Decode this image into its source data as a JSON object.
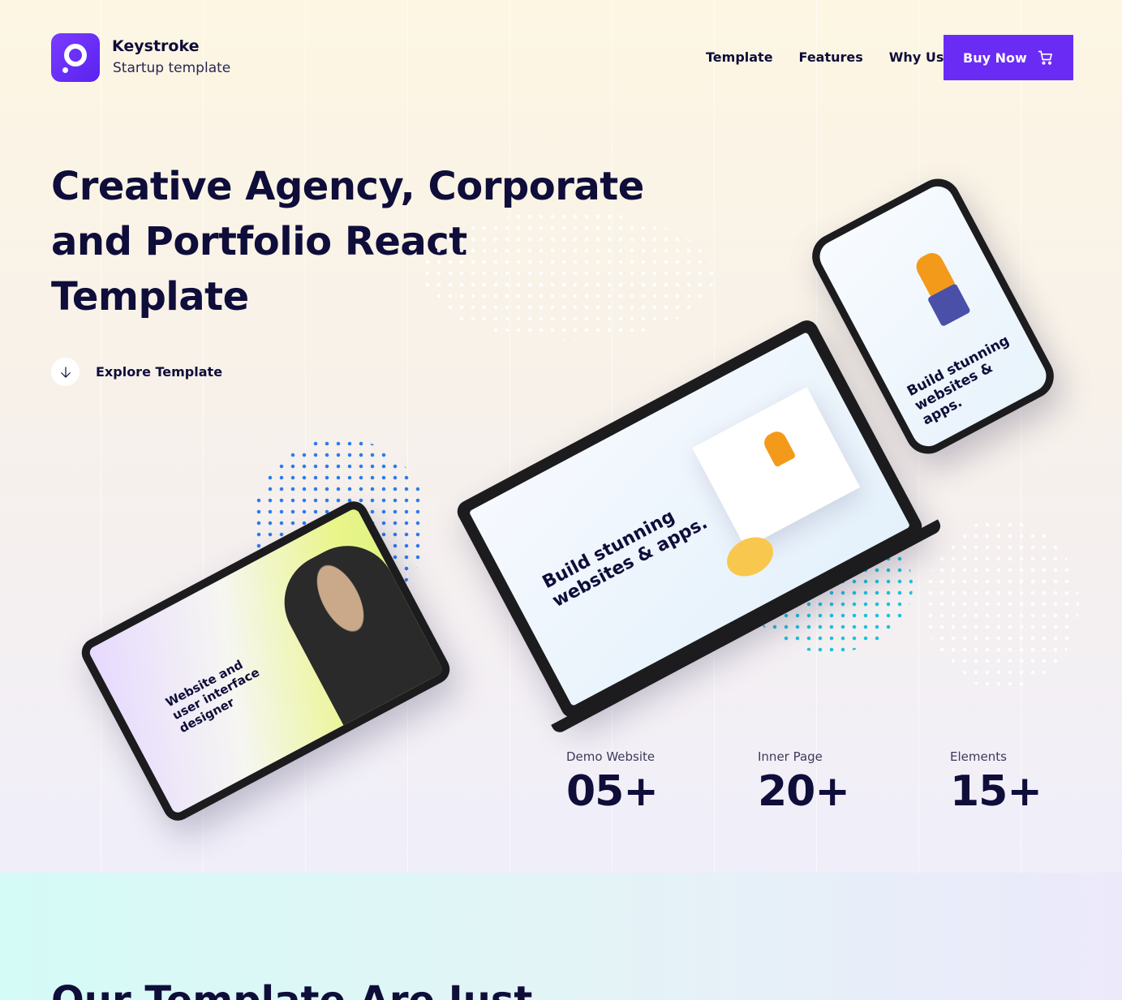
{
  "brand": {
    "name": "Keystroke",
    "tagline": "Startup template"
  },
  "nav": {
    "items": [
      "Template",
      "Features",
      "Why Us"
    ],
    "buy_label": "Buy Now"
  },
  "hero": {
    "title_line1": "Creative Agency, Corporate",
    "title_line2": "and Portfolio React Template",
    "explore_label": "Explore Template"
  },
  "devices": {
    "tablet_text": "Website and user interface designer",
    "laptop_text": "Build stunning websites & apps.",
    "phone_text": "Build stunning websites & apps."
  },
  "stats": [
    {
      "label": "Demo Website",
      "value": "05+"
    },
    {
      "label": "Inner Page",
      "value": "20+"
    },
    {
      "label": "Elements",
      "value": "15+"
    }
  ],
  "section": {
    "title": "Our Template Are Just"
  },
  "colors": {
    "accent": "#6a2cf5",
    "text": "#0f0d3a"
  }
}
